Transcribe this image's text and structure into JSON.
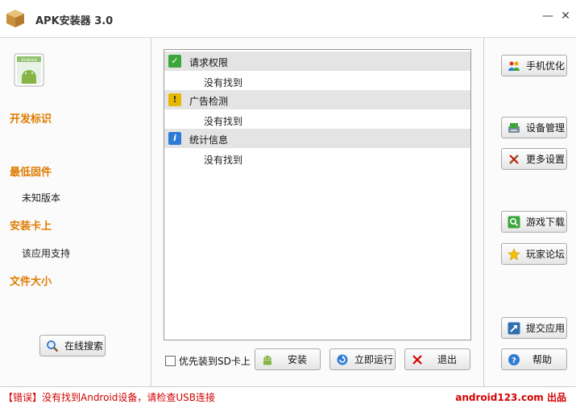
{
  "window": {
    "title": "APK安装器 3.0",
    "minimize": "—",
    "close": "✕"
  },
  "app_icon_text": "Android",
  "info": {
    "dev_label": "开发标识",
    "fw_label": "最低固件",
    "fw_value": "未知版本",
    "sd_label": "安装卡上",
    "sd_value": "该应用支持",
    "size_label": "文件大小"
  },
  "permissions": [
    {
      "title": "请求权限",
      "value": "没有找到",
      "icon": "check-icon",
      "color": "#3aa63a",
      "glyph": "✓"
    },
    {
      "title": "广告检测",
      "value": "没有找到",
      "icon": "warning-icon",
      "color": "#e6b800",
      "glyph": "!"
    },
    {
      "title": "统计信息",
      "value": "没有找到",
      "icon": "info-icon",
      "color": "#2e7bd6",
      "glyph": "i"
    }
  ],
  "buttons": {
    "search": "在线搜索",
    "phone_opt": "手机优化",
    "device_mgr": "设备管理",
    "more_settings": "更多设置",
    "game_download": "游戏下载",
    "forum": "玩家论坛",
    "submit_app": "提交应用",
    "help": "帮助",
    "install": "安装",
    "run_now": "立即运行",
    "exit": "退出"
  },
  "checkbox_label": "优先装到SD卡上",
  "status": {
    "message": "【错误】没有找到Android设备，请检查USB连接",
    "brand": "android123.com 出品"
  }
}
